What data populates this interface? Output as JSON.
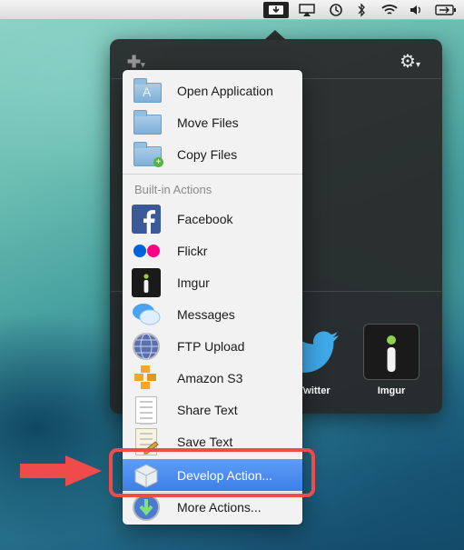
{
  "menubar": {
    "icons": [
      "dropzone-icon",
      "airplay-icon",
      "time-machine-icon",
      "bluetooth-icon",
      "wifi-icon",
      "volume-icon",
      "battery-icon"
    ]
  },
  "panel": {
    "tiles": {
      "twitter_label": "Twitter",
      "imgur_label": "Imgur"
    }
  },
  "menu": {
    "top_items": [
      {
        "label": "Open Application",
        "icon": "applications-folder-icon"
      },
      {
        "label": "Move Files",
        "icon": "folder-icon"
      },
      {
        "label": "Copy Files",
        "icon": "folder-add-icon"
      }
    ],
    "section_title": "Built-in Actions",
    "builtin_items": [
      {
        "label": "Facebook",
        "icon": "facebook-icon"
      },
      {
        "label": "Flickr",
        "icon": "flickr-icon"
      },
      {
        "label": "Imgur",
        "icon": "imgur-icon"
      },
      {
        "label": "Messages",
        "icon": "messages-icon"
      },
      {
        "label": "FTP Upload",
        "icon": "ftp-globe-icon"
      },
      {
        "label": "Amazon S3",
        "icon": "amazon-s3-icon"
      },
      {
        "label": "Share Text",
        "icon": "text-document-icon"
      },
      {
        "label": "Save Text",
        "icon": "save-text-icon"
      }
    ],
    "bottom_items": [
      {
        "label": "Develop Action...",
        "icon": "develop-box-icon",
        "selected": true
      },
      {
        "label": "More Actions...",
        "icon": "download-globe-icon"
      }
    ]
  },
  "colors": {
    "highlight": "#ef4b4b",
    "selection": "#3c7fe9"
  }
}
